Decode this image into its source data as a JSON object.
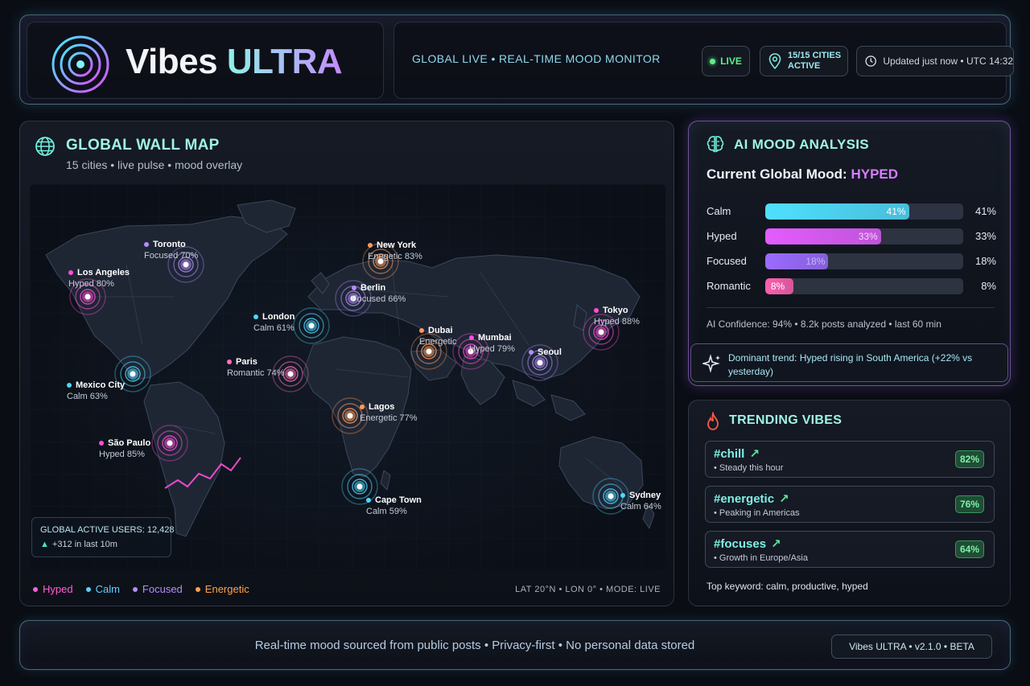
{
  "header": {
    "title_part1": "Vibes",
    "title_part2": "ULTRA",
    "subtitle": "GLOBAL LIVE • REAL-TIME MOOD MONITOR",
    "live_label": "LIVE",
    "cities_active": "15/15 CITIES ACTIVE",
    "updated": "Updated just now • UTC 14:32",
    "icons": [
      "broadcast-logo-icon",
      "location-pin-icon",
      "clock-icon"
    ]
  },
  "map": {
    "title": "GLOBAL WALL MAP",
    "subtitle": "15 cities • live pulse • mood overlay",
    "cities": [
      {
        "name": "Toronto",
        "mood": "Focused",
        "pct": "70%",
        "color": "#b58cff"
      },
      {
        "name": "New York",
        "mood": "Enegetic",
        "pct": "83%",
        "color": "#ff9a5c"
      },
      {
        "name": "Los Angeles",
        "mood": "Hyped",
        "pct": "80%",
        "color": "#ff4fd8"
      },
      {
        "name": "Berlin",
        "mood": "Focused",
        "pct": "66%",
        "color": "#b58cff"
      },
      {
        "name": "London",
        "mood": "Calm",
        "pct": "61%",
        "color": "#4fd7ff"
      },
      {
        "name": "Tokyo",
        "mood": "Hyped",
        "pct": "88%",
        "color": "#ff4fd8"
      },
      {
        "name": "Dubai",
        "mood": "Energetic",
        "pct": "",
        "color": "#ff9a5c"
      },
      {
        "name": "Mumbai",
        "mood": "Hyped",
        "pct": "79%",
        "color": "#ff4fd8"
      },
      {
        "name": "Paris",
        "mood": "Romantic",
        "pct": "74%",
        "color": "#ff6fb8"
      },
      {
        "name": "Seoul",
        "mood": "",
        "pct": "",
        "color": "#b58cff"
      },
      {
        "name": "Mexico City",
        "mood": "Calm",
        "pct": "63%",
        "color": "#4fd7ff"
      },
      {
        "name": "Lagos",
        "mood": "Energetic",
        "pct": "77%",
        "color": "#ff9a5c"
      },
      {
        "name": "São Paulo",
        "mood": "Hyped",
        "pct": "85%",
        "color": "#ff4fd8"
      },
      {
        "name": "Cape Town",
        "mood": "Calm",
        "pct": "59%",
        "color": "#4fd7ff"
      },
      {
        "name": "Sydney",
        "mood": "Calm",
        "pct": "64%",
        "color": "#4fd7ff"
      }
    ],
    "active_users_label": "GLOBAL ACTIVE USERS: 12,428",
    "active_users_delta": "+312 in last 10m",
    "legend": [
      {
        "label": "Hyped",
        "color": "#ff5fd2"
      },
      {
        "label": "Calm",
        "color": "#5fd0ff"
      },
      {
        "label": "Focused",
        "color": "#b58cff"
      },
      {
        "label": "Energetic",
        "color": "#ffa24f"
      }
    ],
    "coords": "LAT 20°N  •  LON 0°  •  MODE: LIVE"
  },
  "ai": {
    "title": "AI MOOD ANALYSIS",
    "current_label": "Current Global Mood:",
    "current_value": "HYPED",
    "bars": [
      {
        "label": "Calm",
        "value": 0.41,
        "text": "41%",
        "color": "#4fe0ff",
        "inner_color": "#ffffff"
      },
      {
        "label": "Hyped",
        "value": 0.33,
        "text": "33%",
        "color": "#e45cff",
        "inner_color": "#f3d6ff"
      },
      {
        "label": "Focused",
        "value": 0.18,
        "text": "18%",
        "color": "#9b6bff",
        "inner_color": "#c9b5ff"
      },
      {
        "label": "Romantic",
        "value": 0.08,
        "text": "8%",
        "color": "#ff5fb0",
        "inner_color": "#ffffff"
      }
    ],
    "stats": "AI Confidence: 94%  •  8.2k posts analyzed  •  last 60 min",
    "trend_text": "Dominant trend: Hyped rising in South America (+22% vs yesterday)"
  },
  "trending": {
    "title": "TRENDING VIBES",
    "items": [
      {
        "tag": "#chill",
        "desc": "• Steady this hour",
        "score": "82%"
      },
      {
        "tag": "#energetic",
        "desc": "• Peaking in Americas",
        "score": "76%"
      },
      {
        "tag": "#focuses",
        "desc": "• Growth in Europe/Asia",
        "score": "64%"
      }
    ],
    "top_keyword": "Top keyword: calm, productive, hyped"
  },
  "footer": {
    "text": "Real-time mood sourced from public posts  •  Privacy-first  •  No personal data stored",
    "version": "Vibes ULTRA  •  v2.1.0  •  BETA"
  }
}
